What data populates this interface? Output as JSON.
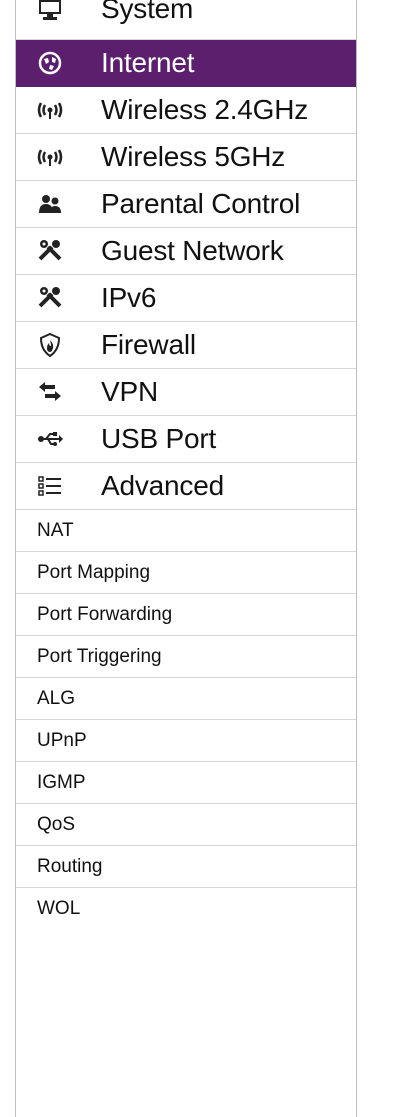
{
  "menu": {
    "items": [
      {
        "label": "System",
        "icon": "monitor-icon"
      },
      {
        "label": "Internet",
        "icon": "globe-icon",
        "active": true
      },
      {
        "label": "Wireless 2.4GHz",
        "icon": "wifi-icon"
      },
      {
        "label": "Wireless 5GHz",
        "icon": "wifi-icon"
      },
      {
        "label": "Parental Control",
        "icon": "users-icon"
      },
      {
        "label": "Guest Network",
        "icon": "tools-icon"
      },
      {
        "label": "IPv6",
        "icon": "tools-icon"
      },
      {
        "label": "Firewall",
        "icon": "shield-fire-icon"
      },
      {
        "label": "VPN",
        "icon": "exchange-icon"
      },
      {
        "label": "USB Port",
        "icon": "usb-icon"
      },
      {
        "label": "Advanced",
        "icon": "list-icon"
      }
    ]
  },
  "submenu": {
    "items": [
      {
        "label": "NAT"
      },
      {
        "label": "Port Mapping"
      },
      {
        "label": "Port Forwarding"
      },
      {
        "label": "Port Triggering"
      },
      {
        "label": "ALG"
      },
      {
        "label": "UPnP"
      },
      {
        "label": "IGMP"
      },
      {
        "label": "QoS"
      },
      {
        "label": "Routing"
      },
      {
        "label": "WOL"
      }
    ]
  },
  "colors": {
    "active_bg": "#5b1f6e",
    "active_text": "#ffffff",
    "text": "#111111"
  }
}
